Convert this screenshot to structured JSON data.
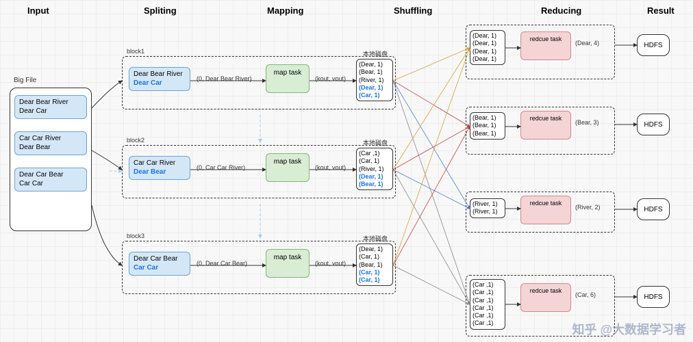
{
  "headers": {
    "input": "Input",
    "splitting": "Spliting",
    "mapping": "Mapping",
    "shuffling": "Shuffling",
    "reducing": "Reducing",
    "result": "Result"
  },
  "bigfile": {
    "title": "Big File",
    "l1a": "Dear Bear River",
    "l1b": "Dear Car",
    "l2a": "Car Car River",
    "l2b": "Dear Bear",
    "l3a": "Dear Car Bear",
    "l3b": "Car Car"
  },
  "blocks": {
    "b1": {
      "name": "block1",
      "s1": "Dear Bear River",
      "s2": "Dear Car",
      "edgein": "(0, Dear Bear River)",
      "task": "map task",
      "edgeout": "(kout, vout)",
      "disk": "本地磁盘",
      "o1": "(Dear, 1)",
      "o2": "(Bear, 1)",
      "o3": "(River, 1)",
      "o4": "(Dear, 1)",
      "o5": "(Car, 1)"
    },
    "b2": {
      "name": "block2",
      "s1": "Car Car River",
      "s2": "Dear Bear",
      "edgein": "(0, Car Car River)",
      "task": "map task",
      "edgeout": "(kout, vout)",
      "disk": "本地磁盘",
      "o1": "(Car ,1)",
      "o2": "(Car, 1)",
      "o3": "(River, 1)",
      "o4": "(Dear, 1)",
      "o5": "(Bear, 1)"
    },
    "b3": {
      "name": "block3",
      "s1": "Dear Car Bear",
      "s2": "Car Car",
      "edgein": "(0, Dear Car Bear)",
      "task": "map task",
      "edgeout": "(kout, vout)",
      "disk": "本地磁盘",
      "o1": "(Dear, 1)",
      "o2": "(Car, 1)",
      "o3": "(Bear, 1)",
      "o4": "(Car, 1)",
      "o5": "(Car, 1)"
    }
  },
  "reducers": {
    "r1": {
      "i1": "(Dear, 1)",
      "i2": "(Dear, 1)",
      "i3": "(Dear, 1)",
      "i4": "(Dear, 1)",
      "task": "redcue task",
      "out": "(Dear, 4)",
      "result": "HDFS"
    },
    "r2": {
      "i1": "(Bear, 1)",
      "i2": "(Bear, 1)",
      "i3": "(Bear, 1)",
      "task": "redcue task",
      "out": "(Bear, 3)",
      "result": "HDFS"
    },
    "r3": {
      "i1": "(River, 1)",
      "i2": "(River, 1)",
      "task": "redcue task",
      "out": "(River, 2)",
      "result": "HDFS"
    },
    "r4": {
      "i1": "(Car ,1)",
      "i2": "(Car ,1)",
      "i3": "(Car ,1)",
      "i4": "(Car ,1)",
      "i5": "(Car ,1)",
      "i6": "(Car ,1)",
      "task": "redcue task",
      "out": "(Car, 6)",
      "result": "HDFS"
    }
  },
  "watermark": "知乎 @大数据学习者"
}
